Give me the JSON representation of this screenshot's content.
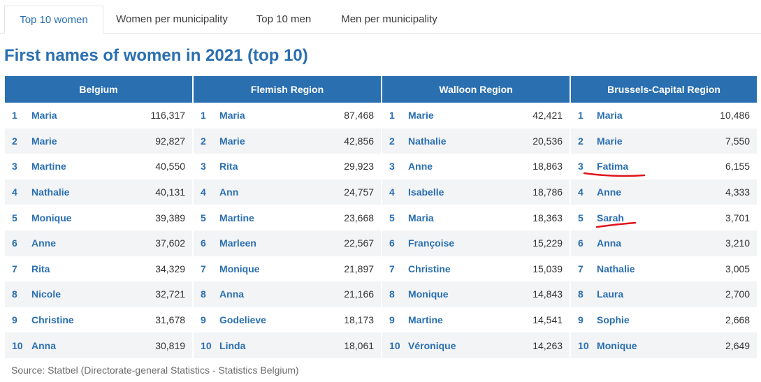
{
  "tabs": [
    {
      "label": "Top 10 women",
      "active": true
    },
    {
      "label": "Women per municipality",
      "active": false
    },
    {
      "label": "Top 10 men",
      "active": false
    },
    {
      "label": "Men per municipality",
      "active": false
    }
  ],
  "title": "First names of women in 2021 (top 10)",
  "colors": {
    "accent": "#2a6fb0",
    "annotation": "#e0141c",
    "row_alt": "#f3f4f6"
  },
  "regions": [
    "Belgium",
    "Flemish Region",
    "Walloon Region",
    "Brussels-Capital Region"
  ],
  "rows": [
    [
      {
        "rank": "1",
        "name": "Maria",
        "count": "116,317"
      },
      {
        "rank": "1",
        "name": "Maria",
        "count": "87,468"
      },
      {
        "rank": "1",
        "name": "Marie",
        "count": "42,421"
      },
      {
        "rank": "1",
        "name": "Maria",
        "count": "10,486"
      }
    ],
    [
      {
        "rank": "2",
        "name": "Marie",
        "count": "92,827"
      },
      {
        "rank": "2",
        "name": "Marie",
        "count": "42,856"
      },
      {
        "rank": "2",
        "name": "Nathalie",
        "count": "20,536"
      },
      {
        "rank": "2",
        "name": "Marie",
        "count": "7,550"
      }
    ],
    [
      {
        "rank": "3",
        "name": "Martine",
        "count": "40,550"
      },
      {
        "rank": "3",
        "name": "Rita",
        "count": "29,923"
      },
      {
        "rank": "3",
        "name": "Anne",
        "count": "18,863"
      },
      {
        "rank": "3",
        "name": "Fatima",
        "count": "6,155",
        "highlighted": true
      }
    ],
    [
      {
        "rank": "4",
        "name": "Nathalie",
        "count": "40,131"
      },
      {
        "rank": "4",
        "name": "Ann",
        "count": "24,757"
      },
      {
        "rank": "4",
        "name": "Isabelle",
        "count": "18,786"
      },
      {
        "rank": "4",
        "name": "Anne",
        "count": "4,333"
      }
    ],
    [
      {
        "rank": "5",
        "name": "Monique",
        "count": "39,389"
      },
      {
        "rank": "5",
        "name": "Martine",
        "count": "23,668"
      },
      {
        "rank": "5",
        "name": "Maria",
        "count": "18,363"
      },
      {
        "rank": "5",
        "name": "Sarah",
        "count": "3,701",
        "highlighted": true
      }
    ],
    [
      {
        "rank": "6",
        "name": "Anne",
        "count": "37,602"
      },
      {
        "rank": "6",
        "name": "Marleen",
        "count": "22,567"
      },
      {
        "rank": "6",
        "name": "Françoise",
        "count": "15,229"
      },
      {
        "rank": "6",
        "name": "Anna",
        "count": "3,210"
      }
    ],
    [
      {
        "rank": "7",
        "name": "Rita",
        "count": "34,329"
      },
      {
        "rank": "7",
        "name": "Monique",
        "count": "21,897"
      },
      {
        "rank": "7",
        "name": "Christine",
        "count": "15,039"
      },
      {
        "rank": "7",
        "name": "Nathalie",
        "count": "3,005"
      }
    ],
    [
      {
        "rank": "8",
        "name": "Nicole",
        "count": "32,721"
      },
      {
        "rank": "8",
        "name": "Anna",
        "count": "21,166"
      },
      {
        "rank": "8",
        "name": "Monique",
        "count": "14,843"
      },
      {
        "rank": "8",
        "name": "Laura",
        "count": "2,700"
      }
    ],
    [
      {
        "rank": "9",
        "name": "Christine",
        "count": "31,678"
      },
      {
        "rank": "9",
        "name": "Godelieve",
        "count": "18,173"
      },
      {
        "rank": "9",
        "name": "Martine",
        "count": "14,541"
      },
      {
        "rank": "9",
        "name": "Sophie",
        "count": "2,668"
      }
    ],
    [
      {
        "rank": "10",
        "name": "Anna",
        "count": "30,819"
      },
      {
        "rank": "10",
        "name": "Linda",
        "count": "18,061"
      },
      {
        "rank": "10",
        "name": "Véronique",
        "count": "14,263"
      },
      {
        "rank": "10",
        "name": "Monique",
        "count": "2,649"
      }
    ]
  ],
  "source": "Source: Statbel (Directorate-general Statistics - Statistics Belgium)"
}
